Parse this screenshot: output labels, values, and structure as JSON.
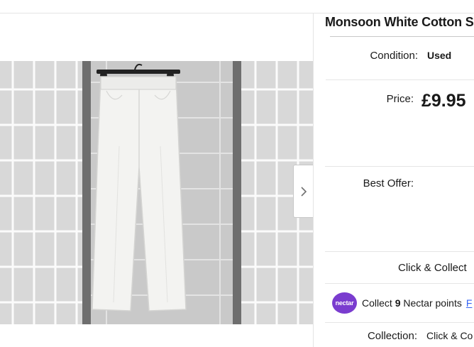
{
  "listing": {
    "title": "Monsoon White Cotton S",
    "condition_label": "Condition:",
    "condition_value": "Used",
    "price_label": "Price:",
    "price_value": "£9.95",
    "best_offer_label": "Best Offer:",
    "click_collect": "Click & Collect",
    "nectar": {
      "logo_text": "nectar",
      "collect_prefix": "Collect",
      "points": "9",
      "points_suffix": "Nectar points",
      "link_text": "F"
    },
    "collection_label": "Collection:",
    "collection_value": "Click & Co"
  },
  "gallery": {
    "image_name": "white-trousers-photo",
    "next_icon": "chevron-right-icon"
  }
}
